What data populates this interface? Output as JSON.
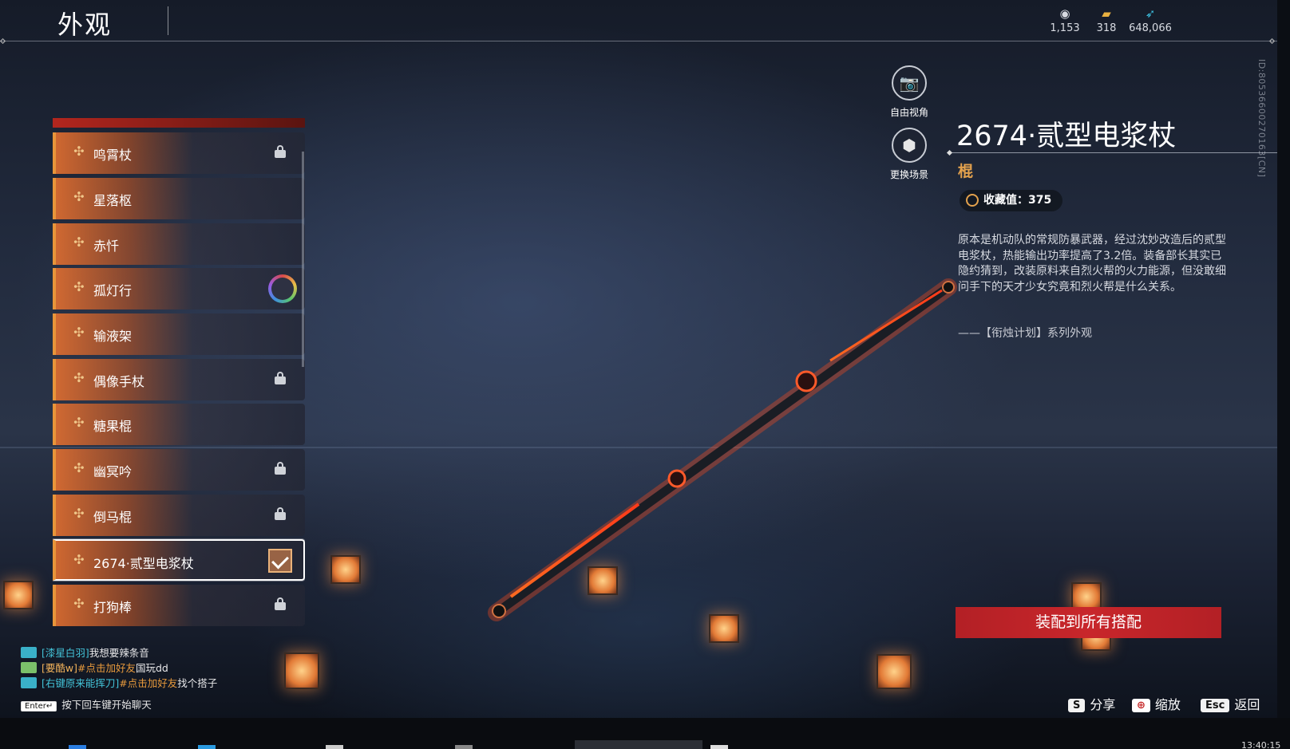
{
  "header": {
    "title": "外观",
    "currencies": [
      {
        "icon": "coin-icon",
        "value": "1,153"
      },
      {
        "icon": "ticket-icon",
        "value": "318"
      },
      {
        "icon": "feather-icon",
        "value": "648,066"
      }
    ]
  },
  "player_id": "ID:8053660027016​3[CN]",
  "list": {
    "items": [
      {
        "label": "鸣霄杖",
        "status": "locked"
      },
      {
        "label": "星落枢",
        "status": "none"
      },
      {
        "label": "赤忏",
        "status": "none"
      },
      {
        "label": "孤灯行",
        "status": "rainbow"
      },
      {
        "label": "输液架",
        "status": "none"
      },
      {
        "label": "偶像手杖",
        "status": "locked"
      },
      {
        "label": "糖果棍",
        "status": "none"
      },
      {
        "label": "幽冥吟",
        "status": "locked"
      },
      {
        "label": "倒马棍",
        "status": "locked"
      },
      {
        "label": "2674·贰型电浆杖",
        "status": "equipped"
      },
      {
        "label": "打狗棒",
        "status": "locked"
      }
    ]
  },
  "view_buttons": {
    "free_view": "自由视角",
    "change_scene": "更换场景"
  },
  "detail": {
    "name": "2674·贰型电浆杖",
    "type": "棍",
    "collect_label": "收藏值：375",
    "description": "原本是机动队的常规防暴武器，经过沈妙改造后的贰型电浆杖，热能输出功率提高了3.2倍。装备部长其实已隐约猜到，改装原料来自烈火帮的火力能源，但没敢细问手下的天才少女究竟和烈火帮是什么关系。",
    "series": "——【衔烛计划】系列外观",
    "equip_button": "装配到所有搭配"
  },
  "hotkeys": [
    {
      "key": "S",
      "label": "分享"
    },
    {
      "key": "⊕",
      "label": "缩放"
    },
    {
      "key": "Esc",
      "label": "返回"
    }
  ],
  "chat": {
    "messages": [
      {
        "channel": "[漆星白羽]",
        "text": "我想要辣条音"
      },
      {
        "channel": "[要酷w]",
        "link": "#点击加好友",
        "text": "国玩dd"
      },
      {
        "channel": "[右键原来能挥刀]",
        "link": "#点击加好友",
        "text": "找个搭子"
      }
    ],
    "enter_key": "Enter↵",
    "prompt": "按下回车键开始聊天"
  },
  "clock": "13:40:15"
}
